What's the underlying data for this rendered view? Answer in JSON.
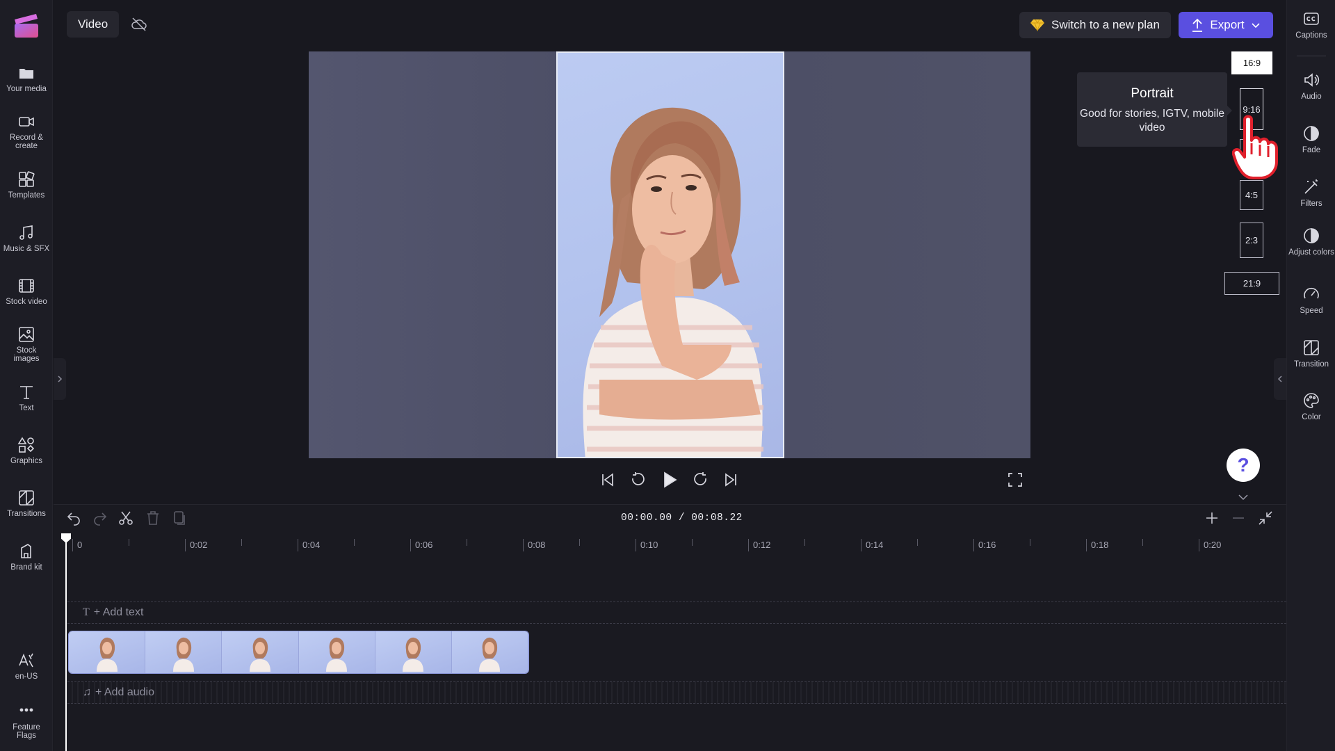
{
  "top_bar": {
    "project_tab": "Video",
    "plan_button": "Switch to a new plan",
    "export_button": "Export"
  },
  "left_nav": [
    {
      "id": "your-media",
      "label": "Your media"
    },
    {
      "id": "record-create",
      "label": "Record & create"
    },
    {
      "id": "templates",
      "label": "Templates"
    },
    {
      "id": "music-sfx",
      "label": "Music & SFX"
    },
    {
      "id": "stock-video",
      "label": "Stock video"
    },
    {
      "id": "stock-images",
      "label": "Stock images"
    },
    {
      "id": "text",
      "label": "Text"
    },
    {
      "id": "graphics",
      "label": "Graphics"
    },
    {
      "id": "transitions",
      "label": "Transitions"
    },
    {
      "id": "brand-kit",
      "label": "Brand kit"
    },
    {
      "id": "language",
      "label": "en-US"
    },
    {
      "id": "feature-flags",
      "label": "Feature Flags"
    }
  ],
  "right_nav": [
    {
      "id": "captions",
      "label": "Captions"
    },
    {
      "id": "audio",
      "label": "Audio"
    },
    {
      "id": "fade",
      "label": "Fade"
    },
    {
      "id": "filters",
      "label": "Filters"
    },
    {
      "id": "adjust-colors",
      "label": "Adjust colors"
    },
    {
      "id": "speed",
      "label": "Speed"
    },
    {
      "id": "transition",
      "label": "Transition"
    },
    {
      "id": "color",
      "label": "Color"
    }
  ],
  "aspect_ratios": {
    "r169": "16:9",
    "r916": "9:16",
    "r11": "",
    "r45": "4:5",
    "r23": "2:3",
    "r219": "21:9",
    "selected": "16:9",
    "hovered": "9:16"
  },
  "tooltip": {
    "title": "Portrait",
    "body": "Good for stories, IGTV, mobile video"
  },
  "help": {
    "label": "?"
  },
  "timeline": {
    "current_time": "00:00.00",
    "separator": " / ",
    "total_time": "00:08.22",
    "ticks": [
      "0",
      "0:02",
      "0:04",
      "0:06",
      "0:08",
      "0:10",
      "0:12",
      "0:14",
      "0:16",
      "0:18",
      "0:20"
    ],
    "add_text": "+ Add text",
    "add_audio": "+ Add audio",
    "clip_thumbnail_count": 6
  },
  "colors": {
    "accent": "#5a4fe0",
    "background": "#18181f",
    "preview_backdrop": "#4c4e66",
    "portrait_bg": "#b6c5ef"
  },
  "icons": {
    "premium": "diamond-icon",
    "export": "upload-icon",
    "cloud": "cloud-off-icon"
  }
}
